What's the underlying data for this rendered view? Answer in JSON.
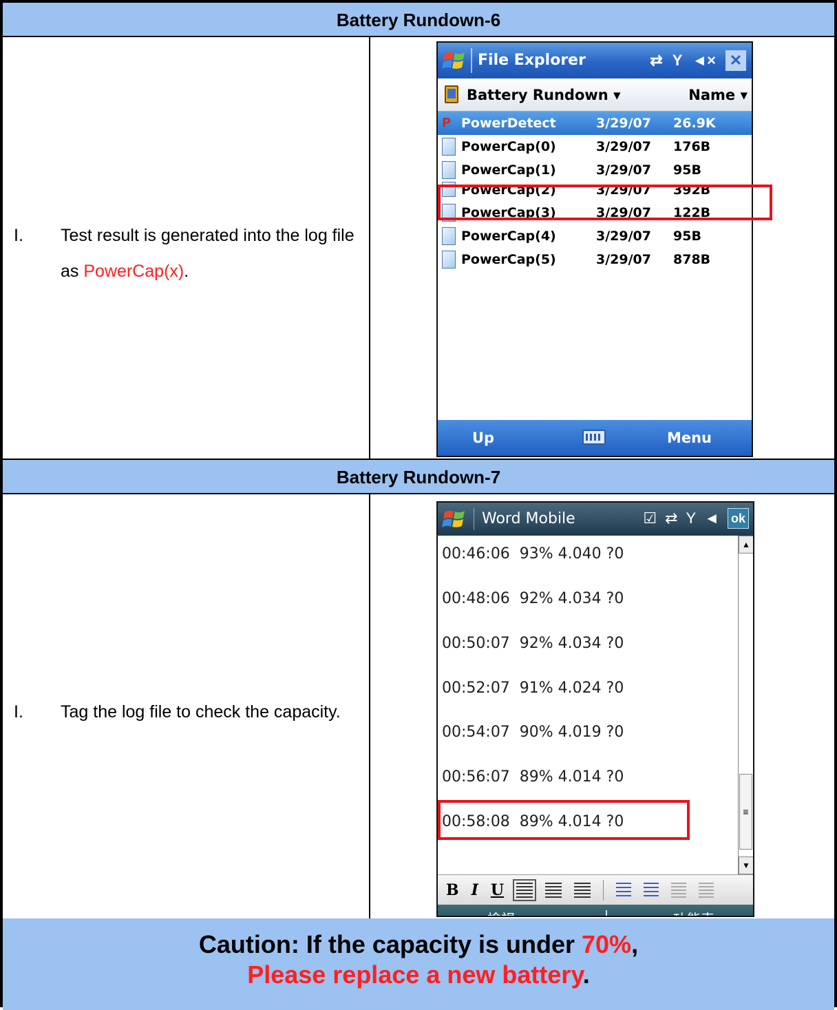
{
  "sections": [
    {
      "header": "Battery Rundown-6",
      "step_number": "I.",
      "step_text_before": "Test result is generated into the log file as ",
      "step_text_highlight": "PowerCap(x)",
      "step_text_after": ".",
      "screen": {
        "title": "File Explorer",
        "folder": "Battery Rundown",
        "sort": "Name",
        "files": [
          {
            "name": "PowerDetect",
            "date": "3/29/07",
            "size": "26.9K"
          },
          {
            "name": "PowerCap(0)",
            "date": "3/29/07",
            "size": "176B"
          },
          {
            "name": "PowerCap(1)",
            "date": "3/29/07",
            "size": "95B"
          },
          {
            "name": "PowerCap(2)",
            "date": "3/29/07",
            "size": "392B"
          },
          {
            "name": "PowerCap(3)",
            "date": "3/29/07",
            "size": "122B"
          },
          {
            "name": "PowerCap(4)",
            "date": "3/29/07",
            "size": "95B"
          },
          {
            "name": "PowerCap(5)",
            "date": "3/29/07",
            "size": "878B"
          }
        ],
        "soft_left": "Up",
        "soft_right": "Menu"
      }
    },
    {
      "header": "Battery Rundown-7",
      "step_number": "I.",
      "step_text": "Tag the log file to check the capacity.",
      "screen": {
        "title": "Word Mobile",
        "ok": "ok",
        "log_lines": [
          "00:46:06  93% 4.040 ?0",
          "00:48:06  92% 4.034 ?0",
          "00:50:07  92% 4.034 ?0",
          "00:52:07  91% 4.024 ?0",
          "00:54:07  90% 4.019 ?0",
          "00:56:07  89% 4.014 ?0",
          "00:58:08  89% 4.014 ?0"
        ],
        "toolbar": {
          "bold": "B",
          "italic": "I",
          "underline": "U"
        },
        "soft_left": "檢視",
        "soft_right": "功能表"
      }
    }
  ],
  "caution": {
    "line1_before": "Caution: If the capacity is under ",
    "line1_highlight": "70%",
    "line1_after": ",",
    "line2_highlight": "Please replace a new battery",
    "line2_after": "."
  },
  "colors": {
    "header_bg": "#9bc2f1",
    "highlight_red": "#ff2020",
    "box_red": "#e8121b"
  }
}
